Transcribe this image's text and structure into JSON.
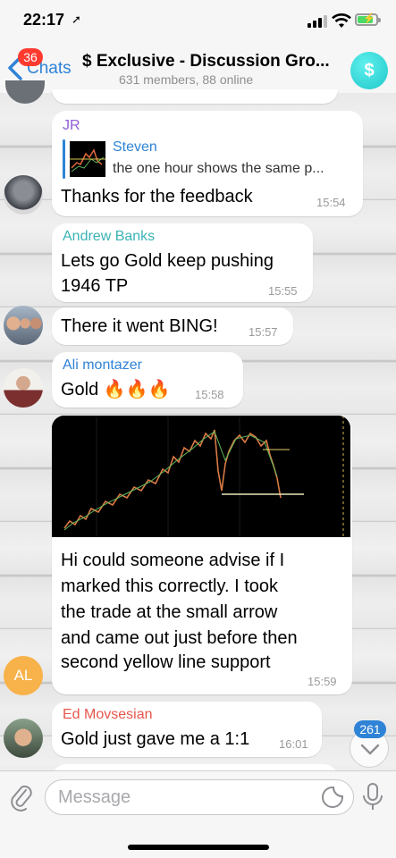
{
  "status_bar": {
    "time": "22:17",
    "location_icon": "location-arrow-icon"
  },
  "header": {
    "back_label": "Chats",
    "unread_badge": "36",
    "title": "$ Exclusive - Discussion Gro...",
    "subtitle": "631 members, 88 online",
    "avatar_glyph": "$"
  },
  "messages": [
    {
      "sender": "JR",
      "sender_color": "#8e5fd6",
      "reply": {
        "name": "Steven",
        "text": "the one hour shows the same p..."
      },
      "text": "Thanks for the feedback",
      "time": "15:54"
    },
    {
      "sender": "Andrew Banks",
      "sender_color": "#3ab3b5",
      "text_lines": [
        "Lets go Gold keep pushing",
        "1946 TP"
      ],
      "time": "15:55"
    },
    {
      "text": "There it went BING!",
      "time": "15:57"
    },
    {
      "sender": "Ali montazer",
      "sender_color": "#2f83d6",
      "text": "Gold 🔥🔥🔥",
      "time": "15:58"
    },
    {
      "avatar_initials": "AL",
      "avatar_color": "#f7b24a",
      "text_lines": [
        "Hi could someone advise if I",
        "marked this correctly. I took",
        "the trade at the small arrow",
        "and came out just before then",
        "second yellow line support"
      ],
      "time": "15:59"
    },
    {
      "sender": "Ed Movsesian",
      "sender_color": "#e5574d",
      "text": "Gold just gave me a 1:1",
      "time": "16:01"
    }
  ],
  "scroll_down": {
    "unread_count": "261"
  },
  "composer": {
    "placeholder": "Message"
  }
}
